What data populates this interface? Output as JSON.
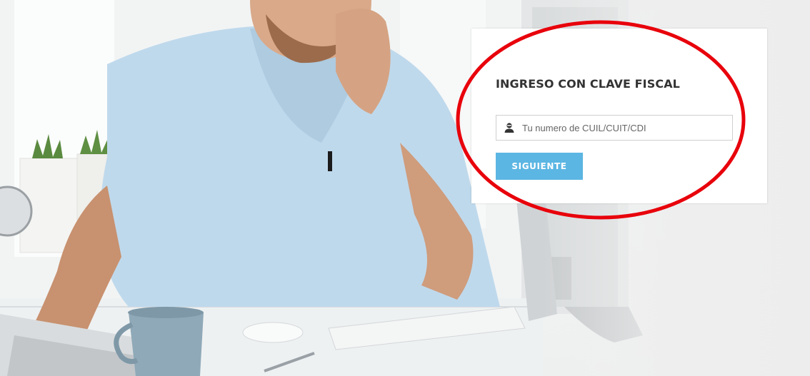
{
  "login": {
    "title": "INGRESO CON CLAVE FISCAL",
    "cuit_placeholder": "Tu numero de CUIL/CUIT/CDI",
    "cuit_value": "",
    "next_label": "SIGUIENTE"
  },
  "icons": {
    "input_icon": "user-icon"
  },
  "colors": {
    "button_bg": "#5cb6e3",
    "button_text": "#ffffff",
    "title_text": "#333333",
    "highlight": "#e8000b"
  }
}
